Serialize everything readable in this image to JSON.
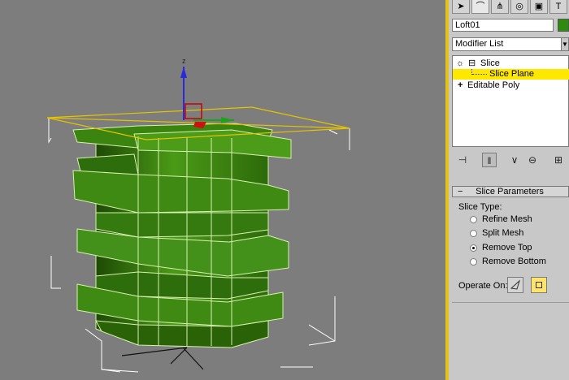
{
  "command_panel": {
    "tabs": [
      {
        "name": "create",
        "glyph": "➤"
      },
      {
        "name": "modify",
        "glyph": "⌒"
      },
      {
        "name": "hierarchy",
        "glyph": "⋔"
      },
      {
        "name": "motion",
        "glyph": "◎"
      },
      {
        "name": "display",
        "glyph": "▣"
      },
      {
        "name": "utilities",
        "glyph": "T"
      }
    ],
    "object_name": "Loft01",
    "object_color": "#2f8a10",
    "modifier_list_label": "Modifier List",
    "stack": {
      "items": [
        {
          "expander": "⊟",
          "label": "Slice"
        },
        {
          "label": "Slice Plane",
          "selected": true
        },
        {
          "expander": "+",
          "label": "Editable Poly"
        }
      ]
    },
    "stack_buttons": [
      "pin-stack",
      "show-end-result",
      "make-unique",
      "remove-modifier",
      "configure-modifier-sets"
    ]
  },
  "slice_parameters": {
    "title": "Slice Parameters",
    "slice_type_label": "Slice Type:",
    "options": [
      {
        "label": "Refine Mesh",
        "checked": false
      },
      {
        "label": "Split Mesh",
        "checked": false
      },
      {
        "label": "Remove Top",
        "checked": true
      },
      {
        "label": "Remove Bottom",
        "checked": false
      }
    ],
    "operate_on_label": "Operate On:",
    "operate_on_active": "polygon"
  },
  "viewport": {
    "background": "#7d7d7d",
    "mesh_color": "#3f8a10",
    "gizmo_color": "#e6c300",
    "axis_label_z": "z"
  }
}
